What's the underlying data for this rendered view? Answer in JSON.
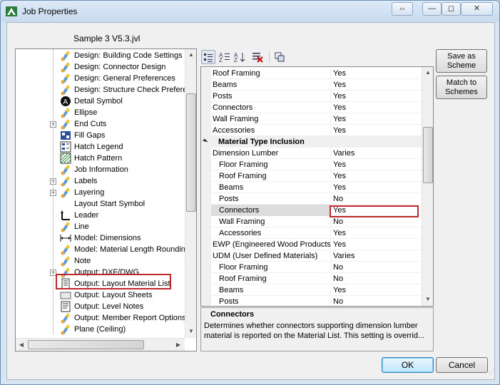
{
  "window": {
    "title": "Job Properties",
    "file_name": "Sample 3 V5.3.jvl",
    "title_buttons": [
      "⇔",
      "—",
      "◻",
      "✕"
    ]
  },
  "tree": {
    "items": [
      {
        "label": "Design: Building Code Settings",
        "icon": "paint-brush-icon",
        "expander": ""
      },
      {
        "label": "Design: Connector Design",
        "icon": "paint-brush-icon",
        "expander": ""
      },
      {
        "label": "Design: General Preferences",
        "icon": "paint-brush-icon",
        "expander": ""
      },
      {
        "label": "Design: Structure Check Preferences",
        "icon": "paint-brush-icon",
        "expander": ""
      },
      {
        "label": "Detail Symbol",
        "icon": "detail-symbol-icon",
        "expander": ""
      },
      {
        "label": "Ellipse",
        "icon": "paint-brush-icon",
        "expander": ""
      },
      {
        "label": "End Cuts",
        "icon": "paint-brush-icon",
        "expander": "+"
      },
      {
        "label": "Fill Gaps",
        "icon": "fill-gaps-icon",
        "expander": ""
      },
      {
        "label": "Hatch Legend",
        "icon": "hatch-legend-icon",
        "expander": ""
      },
      {
        "label": "Hatch Pattern",
        "icon": "hatch-pattern-icon",
        "expander": ""
      },
      {
        "label": "Job Information",
        "icon": "paint-brush-icon",
        "expander": ""
      },
      {
        "label": "Labels",
        "icon": "paint-brush-icon",
        "expander": "+"
      },
      {
        "label": "Layering",
        "icon": "paint-brush-icon",
        "expander": "+"
      },
      {
        "label": "Layout Start Symbol",
        "icon": "none",
        "expander": ""
      },
      {
        "label": "Leader",
        "icon": "leader-icon",
        "expander": ""
      },
      {
        "label": "Line",
        "icon": "paint-brush-icon",
        "expander": ""
      },
      {
        "label": "Model: Dimensions",
        "icon": "dimension-icon",
        "expander": ""
      },
      {
        "label": "Model: Material Length Rounding",
        "icon": "paint-brush-icon",
        "expander": ""
      },
      {
        "label": "Note",
        "icon": "paint-brush-icon",
        "expander": ""
      },
      {
        "label": "Output: DXF/DWG",
        "icon": "paint-brush-icon",
        "expander": "+"
      },
      {
        "label": "Output: Layout Material List",
        "icon": "material-list-icon",
        "expander": ""
      },
      {
        "label": "Output: Layout Sheets",
        "icon": "layout-sheets-icon",
        "expander": ""
      },
      {
        "label": "Output: Level Notes",
        "icon": "level-notes-icon",
        "expander": ""
      },
      {
        "label": "Output: Member Report Options",
        "icon": "paint-brush-icon",
        "expander": ""
      },
      {
        "label": "Plane (Ceiling)",
        "icon": "paint-brush-icon",
        "expander": ""
      }
    ]
  },
  "toolbar": {
    "icons": [
      "categorized-icon",
      "alphabetical-icon",
      "sort-az-icon",
      "clear-icon",
      "property-pages-icon"
    ]
  },
  "grid": {
    "rows": [
      {
        "name": "Roof Framing",
        "value": "Yes",
        "indent": 0,
        "type": "prop"
      },
      {
        "name": "Beams",
        "value": "Yes",
        "indent": 0,
        "type": "prop"
      },
      {
        "name": "Posts",
        "value": "Yes",
        "indent": 0,
        "type": "prop"
      },
      {
        "name": "Connectors",
        "value": "Yes",
        "indent": 0,
        "type": "prop"
      },
      {
        "name": "Wall Framing",
        "value": "Yes",
        "indent": 0,
        "type": "prop"
      },
      {
        "name": "Accessories",
        "value": "Yes",
        "indent": 0,
        "type": "prop"
      },
      {
        "name": "Material Type Inclusion",
        "value": "",
        "indent": 0,
        "type": "category"
      },
      {
        "name": "Dimension Lumber",
        "value": "Varies",
        "indent": 0,
        "type": "prop"
      },
      {
        "name": "Floor Framing",
        "value": "Yes",
        "indent": 1,
        "type": "prop"
      },
      {
        "name": "Roof Framing",
        "value": "Yes",
        "indent": 1,
        "type": "prop"
      },
      {
        "name": "Beams",
        "value": "Yes",
        "indent": 1,
        "type": "prop"
      },
      {
        "name": "Posts",
        "value": "No",
        "indent": 1,
        "type": "prop"
      },
      {
        "name": "Connectors",
        "value": "Yes",
        "indent": 1,
        "type": "selected"
      },
      {
        "name": "Wall Framing",
        "value": "No",
        "indent": 1,
        "type": "prop"
      },
      {
        "name": "Accessories",
        "value": "Yes",
        "indent": 1,
        "type": "prop"
      },
      {
        "name": "EWP (Engineered Wood Products)",
        "value": "Yes",
        "indent": 0,
        "type": "prop"
      },
      {
        "name": "UDM (User Defined Materials)",
        "value": "Varies",
        "indent": 0,
        "type": "prop"
      },
      {
        "name": "Floor Framing",
        "value": "No",
        "indent": 1,
        "type": "prop"
      },
      {
        "name": "Roof Framing",
        "value": "No",
        "indent": 1,
        "type": "prop"
      },
      {
        "name": "Beams",
        "value": "Yes",
        "indent": 1,
        "type": "prop"
      },
      {
        "name": "Posts",
        "value": "No",
        "indent": 1,
        "type": "prop"
      }
    ]
  },
  "description": {
    "title": "Connectors",
    "text": "Determines whether connectors supporting dimension lumber material is reported on the Material List. This setting is overrid..."
  },
  "buttons": {
    "save_as_scheme": "Save as Scheme",
    "match_to_schemes": "Match to Schemes",
    "ok": "OK",
    "cancel": "Cancel"
  },
  "colors": {
    "highlight_border": "#c0272d",
    "selected_row": "#dddddd",
    "category_row": "#f0f0f0"
  }
}
